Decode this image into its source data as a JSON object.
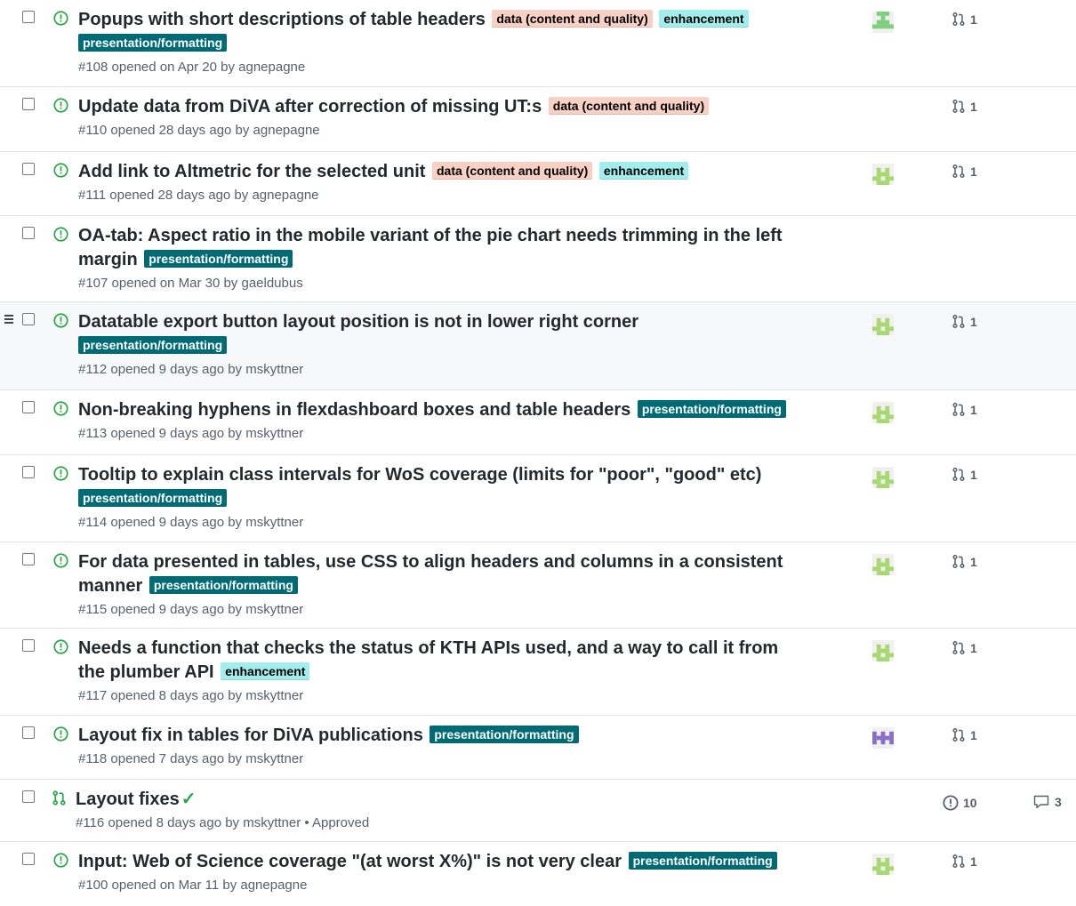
{
  "colors": {
    "open_green": "#28a745",
    "label_data": "#f9d0c4",
    "label_enhancement": "#a2eeef",
    "label_presentation": "#006b75"
  },
  "issues": [
    {
      "title": "Popups with short descriptions of table headers",
      "labels": [
        "data (content and quality)",
        "enhancement",
        "presentation/formatting"
      ],
      "meta": "#108 opened on Apr 20 by agnepagne",
      "pr_count": "1",
      "avatar": "green"
    },
    {
      "title": "Update data from DiVA after correction of missing UT:s",
      "labels": [
        "data (content and quality)"
      ],
      "meta": "#110 opened 28 days ago by agnepagne",
      "pr_count": "1",
      "avatar": "none"
    },
    {
      "title": "Add link to Altmetric for the selected unit",
      "labels": [
        "data (content and quality)",
        "enhancement"
      ],
      "meta": "#111 opened 28 days ago by agnepagne",
      "pr_count": "1",
      "avatar": "green2"
    },
    {
      "title": "OA-tab: Aspect ratio in the mobile variant of the pie chart needs trimming in the left margin",
      "labels": [
        "presentation/formatting"
      ],
      "meta": "#107 opened on Mar 30 by gaeldubus",
      "pr_count": "",
      "avatar": "none"
    },
    {
      "title": "Datatable export button layout position is not in lower right corner",
      "labels": [
        "presentation/formatting"
      ],
      "meta": "#112 opened 9 days ago by mskyttner",
      "pr_count": "1",
      "avatar": "green2"
    },
    {
      "title": "Non-breaking hyphens in flexdashboard boxes and table headers",
      "labels": [
        "presentation/formatting"
      ],
      "meta": "#113 opened 9 days ago by mskyttner",
      "pr_count": "1",
      "avatar": "green2"
    },
    {
      "title": "Tooltip to explain class intervals for WoS coverage (limits for \"poor\", \"good\" etc)",
      "labels": [
        "presentation/formatting"
      ],
      "meta": "#114 opened 9 days ago by mskyttner",
      "pr_count": "1",
      "avatar": "green2"
    },
    {
      "title": "For data presented in tables, use CSS to align headers and columns in a consistent manner",
      "labels": [
        "presentation/formatting"
      ],
      "meta": "#115 opened 9 days ago by mskyttner",
      "pr_count": "1",
      "avatar": "green2"
    },
    {
      "title": "Needs a function that checks the status of KTH APIs used, and a way to call it from the plumber API",
      "labels": [
        "enhancement"
      ],
      "meta": "#117 opened 8 days ago by mskyttner",
      "pr_count": "1",
      "avatar": "green2"
    },
    {
      "title": "Layout fix in tables for DiVA publications",
      "labels": [
        "presentation/formatting"
      ],
      "meta": "#118 opened 7 days ago by mskyttner",
      "pr_count": "1",
      "avatar": "purple"
    },
    {
      "title": "Layout fixes",
      "labels": [],
      "meta": "#116 opened 8 days ago by mskyttner • Approved",
      "type": "pr",
      "issue_count": "10",
      "comment_count": "3"
    },
    {
      "title": "Input: Web of Science coverage \"(at worst X%)\" is not very clear",
      "labels": [
        "presentation/formatting"
      ],
      "meta": "#100 opened on Mar 11 by agnepagne",
      "pr_count": "1",
      "avatar": "green2"
    }
  ]
}
